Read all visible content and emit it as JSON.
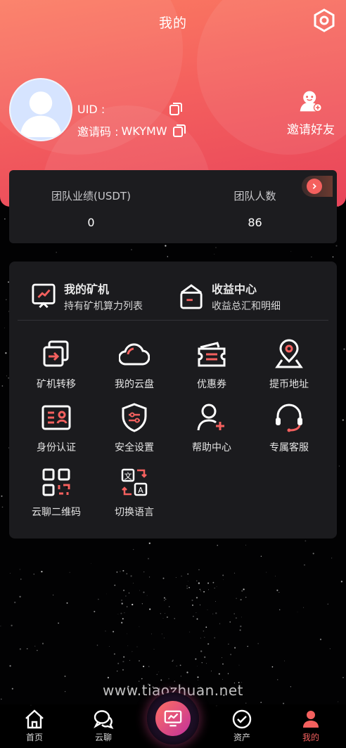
{
  "header": {
    "title": "我的",
    "uid_label": "UID :",
    "uid_value": "",
    "invite_code_label": "邀请码 :",
    "invite_code_value": "WKYMW",
    "invite_friends_label": "邀请好友"
  },
  "team": {
    "performance_label": "团队业绩(USDT)",
    "performance_value": "0",
    "members_label": "团队人数",
    "members_value": "86"
  },
  "features": [
    {
      "title": "我的矿机",
      "subtitle": "持有矿机算力列表",
      "icon": "miner-chart-icon"
    },
    {
      "title": "收益中心",
      "subtitle": "收益总汇和明细",
      "icon": "wallet-bag-icon"
    }
  ],
  "grid": [
    {
      "label": "矿机转移",
      "icon": "transfer-icon"
    },
    {
      "label": "我的云盘",
      "icon": "cloud-icon"
    },
    {
      "label": "优惠券",
      "icon": "coupon-icon"
    },
    {
      "label": "提币地址",
      "icon": "location-pin-icon"
    },
    {
      "label": "身份认证",
      "icon": "id-card-icon"
    },
    {
      "label": "安全设置",
      "icon": "shield-icon"
    },
    {
      "label": "帮助中心",
      "icon": "add-user-icon"
    },
    {
      "label": "专属客服",
      "icon": "headset-icon"
    },
    {
      "label": "云聊二维码",
      "icon": "qr-code-icon"
    },
    {
      "label": "切换语言",
      "icon": "translate-icon"
    }
  ],
  "watermark": "www.tiaozhuan.net",
  "tabs": [
    {
      "label": "首页",
      "icon": "home-icon"
    },
    {
      "label": "云聊",
      "icon": "chat-icon"
    },
    {
      "label": "资产",
      "icon": "check-circle-icon"
    },
    {
      "label": "我的",
      "icon": "user-icon",
      "active": true
    }
  ],
  "colors": {
    "accent": "#f4605e",
    "card_bg": "#1b1b1e",
    "page_bg": "#020203"
  }
}
